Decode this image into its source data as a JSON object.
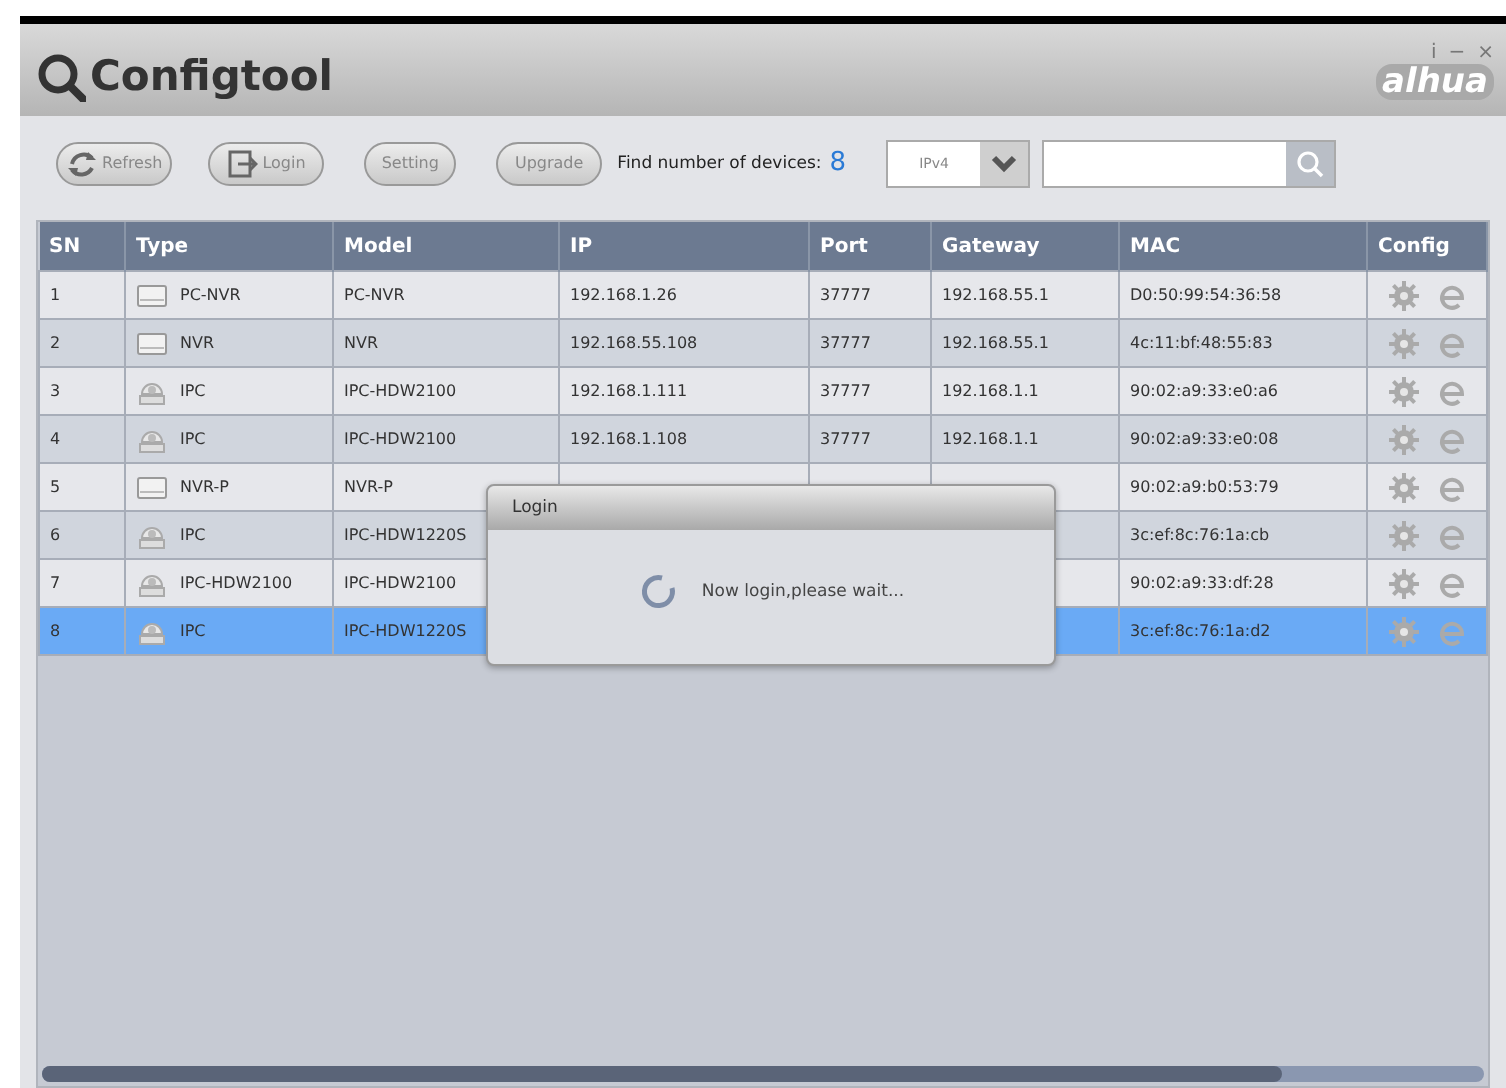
{
  "window": {
    "title": "Configtool",
    "logo": "alhua",
    "controls": [
      "i",
      "−",
      "×"
    ]
  },
  "toolbar": {
    "buttons": [
      {
        "label": "Refresh",
        "kind": "refresh"
      },
      {
        "label": "Login",
        "kind": "login"
      },
      {
        "label": "Setting",
        "kind": "plain"
      },
      {
        "label": "Upgrade",
        "kind": "plain"
      }
    ],
    "device_count_label": "Find number of devices:",
    "device_count": "8",
    "protocol": "IPv4"
  },
  "table": {
    "columns": [
      "SN",
      "Type",
      "Model",
      "IP",
      "Port",
      "Gateway",
      "MAC",
      "Config"
    ],
    "rows": [
      {
        "sn": "1",
        "kind": "recorder",
        "type": "PC-NVR",
        "model": "PC-NVR",
        "ip": "192.168.1.26",
        "port": "37777",
        "gateway": "192.168.55.1",
        "mac": "D0:50:99:54:36:58",
        "selected": false
      },
      {
        "sn": "2",
        "kind": "recorder",
        "type": "NVR",
        "model": "NVR",
        "ip": "192.168.55.108",
        "port": "37777",
        "gateway": "192.168.55.1",
        "mac": "4c:11:bf:48:55:83",
        "selected": false
      },
      {
        "sn": "3",
        "kind": "camera",
        "type": "IPC",
        "model": "IPC-HDW2100",
        "ip": "192.168.1.111",
        "port": "37777",
        "gateway": "192.168.1.1",
        "mac": "90:02:a9:33:e0:a6",
        "selected": false
      },
      {
        "sn": "4",
        "kind": "camera",
        "type": "IPC",
        "model": "IPC-HDW2100",
        "ip": "192.168.1.108",
        "port": "37777",
        "gateway": "192.168.1.1",
        "mac": "90:02:a9:33:e0:08",
        "selected": false
      },
      {
        "sn": "5",
        "kind": "recorder",
        "type": "NVR-P",
        "model": "NVR-P",
        "mac": "90:02:a9:b0:53:79",
        "selected": false
      },
      {
        "sn": "6",
        "kind": "camera",
        "type": "IPC",
        "model": "IPC-HDW1220S",
        "mac": "3c:ef:8c:76:1a:cb",
        "selected": false
      },
      {
        "sn": "7",
        "kind": "camera",
        "type": "IPC-HDW2100",
        "model": "IPC-HDW2100",
        "mac": "90:02:a9:33:df:28",
        "selected": false
      },
      {
        "sn": "8",
        "kind": "camera",
        "type": "IPC",
        "model": "IPC-HDW1220S",
        "mac": "3c:ef:8c:76:1a:d2",
        "selected": true
      }
    ]
  },
  "dialog": {
    "title": "Login",
    "message": "Now login,please wait..."
  }
}
